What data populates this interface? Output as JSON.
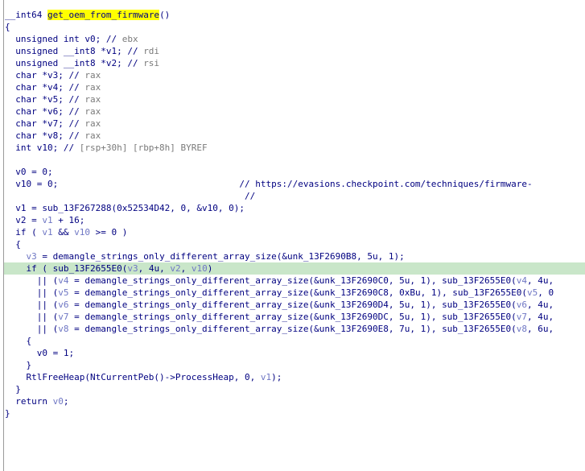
{
  "view": {
    "lines": [
      {
        "segments": [
          {
            "t": "__int64 ",
            "c": "plain"
          },
          {
            "t": "get_oem_from_firmware",
            "c": "fname"
          },
          {
            "t": "()",
            "c": "plain"
          }
        ]
      },
      {
        "segments": [
          {
            "t": "{",
            "c": "plain"
          }
        ]
      },
      {
        "segments": [
          {
            "t": "  unsigned int v0; // ",
            "c": "plain"
          },
          {
            "t": "ebx",
            "c": "comment"
          }
        ]
      },
      {
        "segments": [
          {
            "t": "  unsigned __int8 *v1; // ",
            "c": "plain"
          },
          {
            "t": "rdi",
            "c": "comment"
          }
        ]
      },
      {
        "segments": [
          {
            "t": "  unsigned __int8 *v2; // ",
            "c": "plain"
          },
          {
            "t": "rsi",
            "c": "comment"
          }
        ]
      },
      {
        "segments": [
          {
            "t": "  char *v3; // ",
            "c": "plain"
          },
          {
            "t": "rax",
            "c": "comment"
          }
        ]
      },
      {
        "segments": [
          {
            "t": "  char *v4; // ",
            "c": "plain"
          },
          {
            "t": "rax",
            "c": "comment"
          }
        ]
      },
      {
        "segments": [
          {
            "t": "  char *v5; // ",
            "c": "plain"
          },
          {
            "t": "rax",
            "c": "comment"
          }
        ]
      },
      {
        "segments": [
          {
            "t": "  char *v6; // ",
            "c": "plain"
          },
          {
            "t": "rax",
            "c": "comment"
          }
        ]
      },
      {
        "segments": [
          {
            "t": "  char *v7; // ",
            "c": "plain"
          },
          {
            "t": "rax",
            "c": "comment"
          }
        ]
      },
      {
        "segments": [
          {
            "t": "  char *v8; // ",
            "c": "plain"
          },
          {
            "t": "rax",
            "c": "comment"
          }
        ]
      },
      {
        "segments": [
          {
            "t": "  int v10; // ",
            "c": "plain"
          },
          {
            "t": "[rsp+30h] [rbp+8h] BYREF",
            "c": "comment"
          }
        ]
      },
      {
        "segments": [
          {
            "t": "",
            "c": "plain"
          }
        ]
      },
      {
        "segments": [
          {
            "t": "  v0 = 0;",
            "c": "plain"
          }
        ]
      },
      {
        "segments": [
          {
            "t": "  v10 = 0;                                  // https://evasions.checkpoint.com/techniques/firmware-",
            "c": "plain"
          }
        ]
      },
      {
        "segments": [
          {
            "t": "                                             //",
            "c": "plain"
          }
        ]
      },
      {
        "segments": [
          {
            "t": "  v1 = sub_13F267288(0x52534D42, 0, &v10, 0);",
            "c": "plain"
          }
        ]
      },
      {
        "segments": [
          {
            "t": "  v2 = ",
            "c": "plain"
          },
          {
            "t": "v1",
            "c": "var"
          },
          {
            "t": " + 16;",
            "c": "plain"
          }
        ]
      },
      {
        "segments": [
          {
            "t": "  if ( ",
            "c": "plain"
          },
          {
            "t": "v1",
            "c": "var"
          },
          {
            "t": " && ",
            "c": "plain"
          },
          {
            "t": "v10",
            "c": "var"
          },
          {
            "t": " >= 0 )",
            "c": "plain"
          }
        ]
      },
      {
        "segments": [
          {
            "t": "  {",
            "c": "plain"
          }
        ]
      },
      {
        "segments": [
          {
            "t": "    ",
            "c": "plain"
          },
          {
            "t": "v3",
            "c": "var"
          },
          {
            "t": " = demangle_strings_only_different_array_size(&unk_13F2690B8, 5u, 1);",
            "c": "plain"
          }
        ]
      },
      {
        "highlight": true,
        "segments": [
          {
            "t": "    if ( sub_13F2655E0(",
            "c": "plain"
          },
          {
            "t": "v3",
            "c": "var"
          },
          {
            "t": ", 4u, ",
            "c": "plain"
          },
          {
            "t": "v2",
            "c": "var"
          },
          {
            "t": ", ",
            "c": "plain"
          },
          {
            "t": "v10",
            "c": "var"
          },
          {
            "t": ")",
            "c": "plain"
          }
        ]
      },
      {
        "segments": [
          {
            "t": "      || (",
            "c": "plain"
          },
          {
            "t": "v4",
            "c": "var"
          },
          {
            "t": " = demangle_strings_only_different_array_size(&unk_13F2690C0, 5u, 1), sub_13F2655E0(",
            "c": "plain"
          },
          {
            "t": "v4",
            "c": "var"
          },
          {
            "t": ", 4u,",
            "c": "plain"
          }
        ]
      },
      {
        "segments": [
          {
            "t": "      || (",
            "c": "plain"
          },
          {
            "t": "v5",
            "c": "var"
          },
          {
            "t": " = demangle_strings_only_different_array_size(&unk_13F2690C8, 0xBu, 1), sub_13F2655E0(",
            "c": "plain"
          },
          {
            "t": "v5",
            "c": "var"
          },
          {
            "t": ", 0",
            "c": "plain"
          }
        ]
      },
      {
        "segments": [
          {
            "t": "      || (",
            "c": "plain"
          },
          {
            "t": "v6",
            "c": "var"
          },
          {
            "t": " = demangle_strings_only_different_array_size(&unk_13F2690D4, 5u, 1), sub_13F2655E0(",
            "c": "plain"
          },
          {
            "t": "v6",
            "c": "var"
          },
          {
            "t": ", 4u,",
            "c": "plain"
          }
        ]
      },
      {
        "segments": [
          {
            "t": "      || (",
            "c": "plain"
          },
          {
            "t": "v7",
            "c": "var"
          },
          {
            "t": " = demangle_strings_only_different_array_size(&unk_13F2690DC, 5u, 1), sub_13F2655E0(",
            "c": "plain"
          },
          {
            "t": "v7",
            "c": "var"
          },
          {
            "t": ", 4u,",
            "c": "plain"
          }
        ]
      },
      {
        "segments": [
          {
            "t": "      || (",
            "c": "plain"
          },
          {
            "t": "v8",
            "c": "var"
          },
          {
            "t": " = demangle_strings_only_different_array_size(&unk_13F2690E8, 7u, 1), sub_13F2655E0(",
            "c": "plain"
          },
          {
            "t": "v8",
            "c": "var"
          },
          {
            "t": ", 6u,",
            "c": "plain"
          }
        ]
      },
      {
        "segments": [
          {
            "t": "    {",
            "c": "plain"
          }
        ]
      },
      {
        "segments": [
          {
            "t": "      v0 = 1;",
            "c": "plain"
          }
        ]
      },
      {
        "segments": [
          {
            "t": "    }",
            "c": "plain"
          }
        ]
      },
      {
        "segments": [
          {
            "t": "    RtlFreeHeap(NtCurrentPeb()->ProcessHeap, 0, ",
            "c": "plain"
          },
          {
            "t": "v1",
            "c": "var"
          },
          {
            "t": ");",
            "c": "plain"
          }
        ]
      },
      {
        "segments": [
          {
            "t": "  }",
            "c": "plain"
          }
        ]
      },
      {
        "segments": [
          {
            "t": "  return ",
            "c": "plain"
          },
          {
            "t": "v0",
            "c": "var"
          },
          {
            "t": ";",
            "c": "plain"
          }
        ]
      },
      {
        "segments": [
          {
            "t": "}",
            "c": "plain"
          }
        ]
      }
    ]
  },
  "colors": {
    "code": "#000080",
    "comment": "#7a7a7a",
    "variable": "#6f77c4",
    "function_highlight": "#ffff00",
    "line_highlight": "#c9e6c9"
  }
}
